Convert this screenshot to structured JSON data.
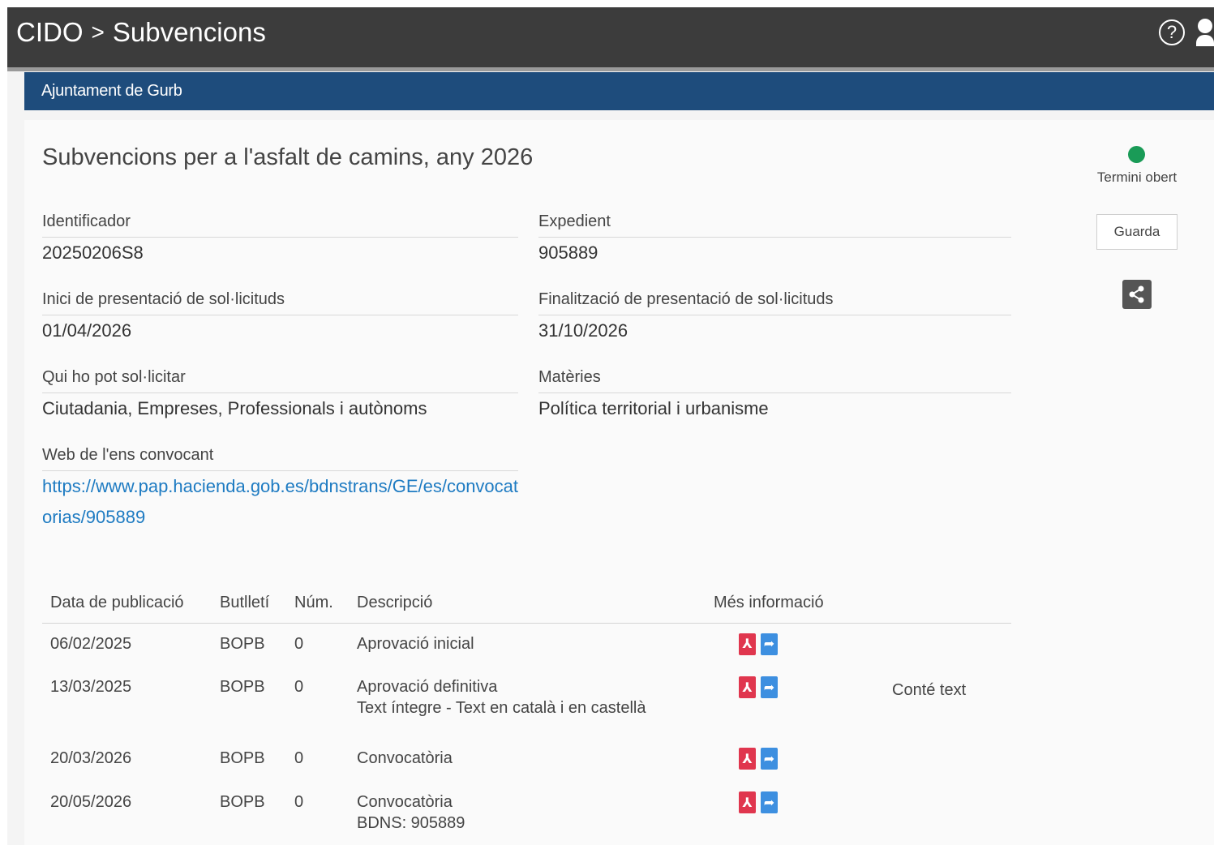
{
  "header": {
    "app_name": "CIDO",
    "separator": ">",
    "section": "Subvencions",
    "icons": [
      "help-icon",
      "user-icon"
    ]
  },
  "entity": {
    "name": "Ajuntament de Gurb"
  },
  "grant": {
    "title": "Subvencions per a l'asfalt de camins, any 2026",
    "status_label": "Termini obert",
    "status_color": "#1a9b57",
    "save_label": "Guarda",
    "fields": {
      "identifier": {
        "label": "Identificador",
        "value": "20250206S8"
      },
      "expedient": {
        "label": "Expedient",
        "value": "905889"
      },
      "start_date": {
        "label": "Inici de presentació de sol·licituds",
        "value": "01/04/2026"
      },
      "end_date": {
        "label": "Finalització de presentació de sol·licituds",
        "value": "31/10/2026"
      },
      "who": {
        "label": "Qui ho pot sol·licitar",
        "value": "Ciutadania, Empreses, Professionals i autònoms"
      },
      "subjects": {
        "label": "Matèries",
        "value": "Política territorial i urbanisme"
      },
      "web": {
        "label": "Web de l'ens convocant",
        "value": "https://www.pap.hacienda.gob.es/bdnstrans/GE/es/convocatorias/905889"
      }
    }
  },
  "publications": {
    "headers": {
      "date": "Data de publicació",
      "bulletin": "Butlletí",
      "num": "Núm.",
      "description": "Descripció",
      "more": "Més informació"
    },
    "rows": [
      {
        "date": "06/02/2025",
        "bulletin": "BOPB",
        "num": "0",
        "description": "Aprovació inicial",
        "extra": "",
        "note": ""
      },
      {
        "date": "13/03/2025",
        "bulletin": "BOPB",
        "num": "0",
        "description": "Aprovació definitiva",
        "extra": "Text íntegre - Text en català i en castellà",
        "note": "Conté text"
      },
      {
        "date": "20/03/2026",
        "bulletin": "BOPB",
        "num": "0",
        "description": "Convocatòria",
        "extra": "",
        "note": ""
      },
      {
        "date": "20/05/2026",
        "bulletin": "BOPB",
        "num": "0",
        "description": "Convocatòria",
        "extra": "BDNS: 905889",
        "note": ""
      }
    ]
  }
}
